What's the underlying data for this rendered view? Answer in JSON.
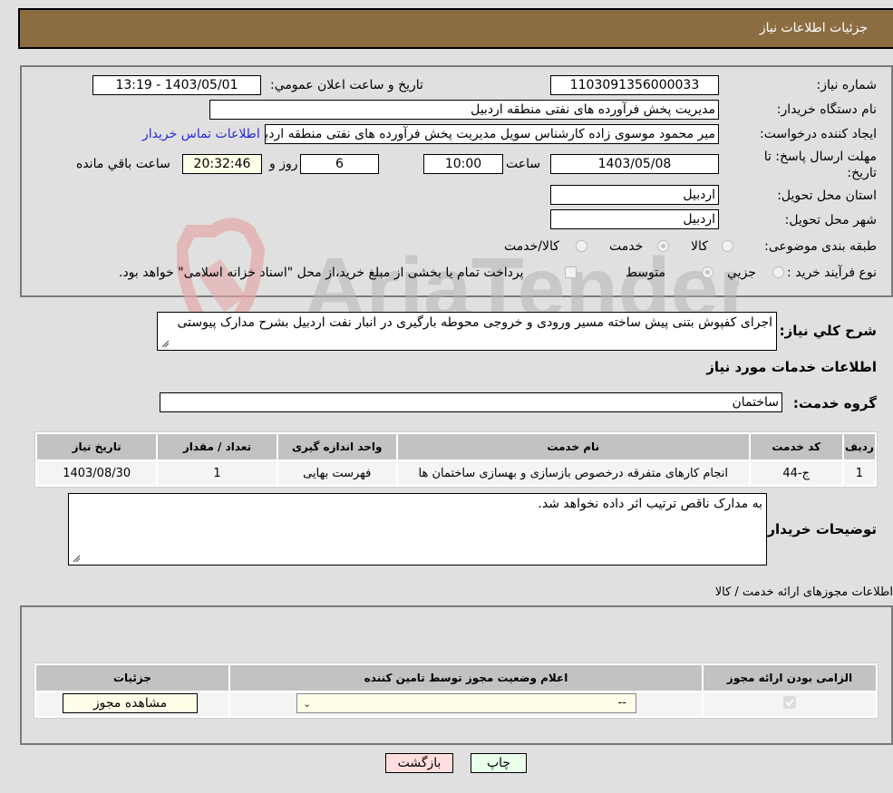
{
  "header": {
    "title": "جزئیات اطلاعات نیاز"
  },
  "form": {
    "need_number_label": "شماره نیاز:",
    "need_number": "1103091356000033",
    "announce_label": "تاریخ و ساعت اعلان عمومي:",
    "announce_value": "1403/05/01 - 13:19",
    "buyer_org_label": "نام دستگاه خریدار:",
    "buyer_org": "مدیریت پخش فرآورده های نفتی منطقه اردبیل",
    "creator_label": "ایجاد کننده درخواست:",
    "creator": "میر محمود موسوی زاده کارشناس سویل مدیریت پخش فرآورده های نفتی منطقه اردبیل",
    "contact_link": "اطلاعات تماس خریدار",
    "deadline_label": "مهلت ارسال پاسخ: تا تاریخ:",
    "deadline_date": "1403/05/08",
    "time_label": "ساعت",
    "deadline_time": "10:00",
    "days_value": "6",
    "days_label": "روز و",
    "remaining_time": "20:32:46",
    "remaining_label": "ساعت باقي مانده",
    "province_label": "استان محل تحویل:",
    "province": "اردبیل",
    "city_label": "شهر محل تحویل:",
    "city": "اردبیل",
    "category_label": "طبقه بندی موضوعی:",
    "category_options": [
      {
        "label": "کالا",
        "checked": false
      },
      {
        "label": "خدمت",
        "checked": true
      },
      {
        "label": "کالا/خدمت",
        "checked": false
      }
    ],
    "process_label": "نوع فرآیند خرید :",
    "process_options": [
      {
        "label": "جزیي",
        "checked": false
      },
      {
        "label": "متوسط",
        "checked": true
      }
    ],
    "treasury_note": "پرداخت تمام یا بخشی از مبلغ خرید،از محل \"اسناد خزانه اسلامی\" خواهد بود.",
    "treasury_checked": false
  },
  "description": {
    "label": "شرح کلي نياز:",
    "text": "اجرای کفپوش بتنی پیش ساخته مسیر ورودی و خروجی محوطه بارگیری در انبار نفت اردبیل بشرح مدارک پیوستی"
  },
  "services": {
    "title": "اطلاعات خدمات مورد نیاز",
    "group_label": "گروه خدمت:",
    "group_value": "ساختمان",
    "columns": [
      "ردیف",
      "کد خدمت",
      "نام خدمت",
      "واحد اندازه گیری",
      "تعداد / مقدار",
      "تاریخ نیاز"
    ],
    "rows": [
      [
        "1",
        "ج-44",
        "انجام کارهای متفرقه درخصوص بازسازی و بهسازی ساختمان ها",
        "فهرست بهایی",
        "1",
        "1403/08/30"
      ]
    ]
  },
  "buyer_notes": {
    "label": "توضیحات خریدار:",
    "text": "به مدارک ناقص ترتیب اثر داده نخواهد شد."
  },
  "licenses": {
    "title": "اطلاعات مجوزهای ارائه خدمت / کالا",
    "columns": [
      "الزامی بودن ارائه مجوز",
      "اعلام وضعیت مجوز توسط تامین کننده",
      "جزئیات"
    ],
    "rows": [
      {
        "required": true,
        "status": "--",
        "details_button": "مشاهده مجوز"
      }
    ]
  },
  "buttons": {
    "print": "چاپ",
    "back": "بازگشت"
  },
  "colors": {
    "header_bg": "#8c6d42",
    "link": "#2727d6",
    "back_btn": "#ffdede",
    "print_btn": "#eaffea"
  }
}
